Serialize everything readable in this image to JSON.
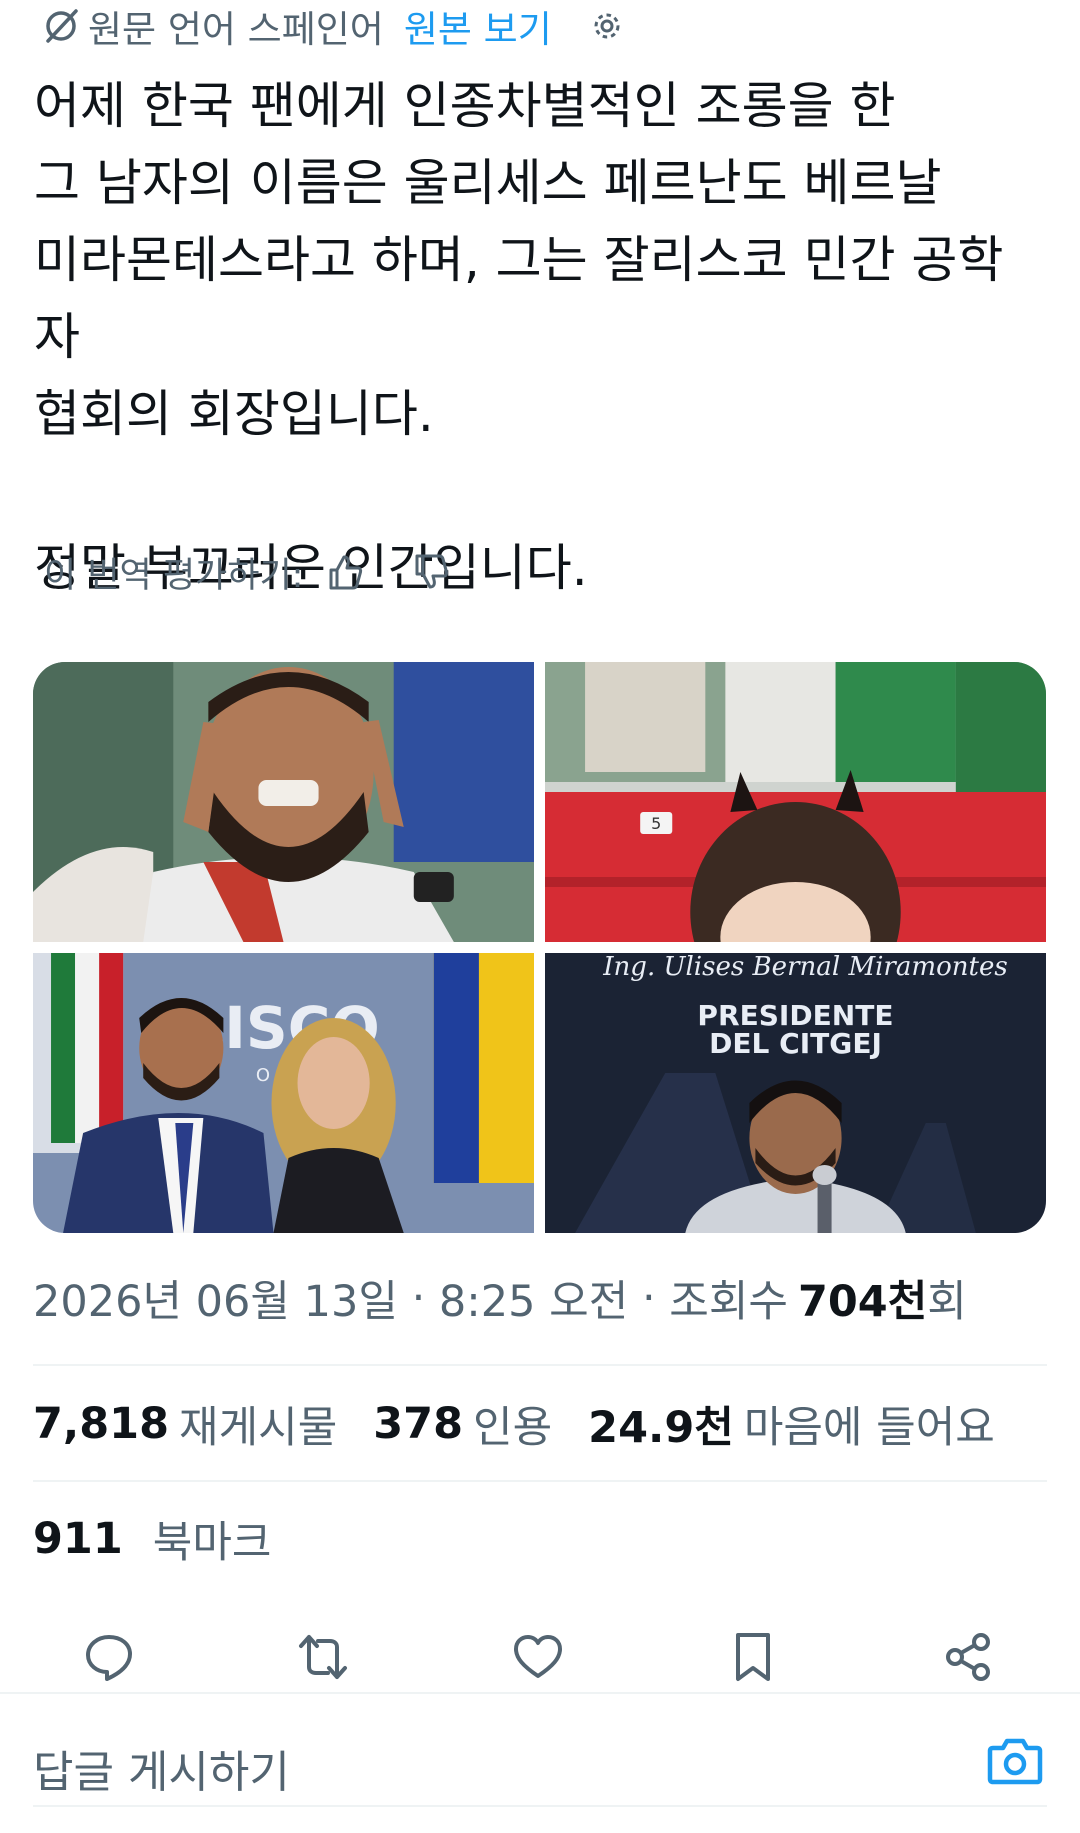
{
  "translation": {
    "source_language": "원문 언어 스페인어",
    "view_original": "원본 보기",
    "icons": {
      "translate": "translate-icon",
      "settings": "gear-icon"
    }
  },
  "tweet": {
    "text": "어제 한국 팬에게 인종차별적인 조롱을 한\n그 남자의 이름은 울리세스 페르난도 베르날\n미라몬테스라고 하며, 그는 잘리스코 민간 공학자\n협회의 회장입니다.\n\n정말 부끄러운 인간입니다.",
    "rate_label": "이 번역 평가하기:",
    "rate_icons": [
      "thumbs-up-icon",
      "thumbs-down-icon"
    ]
  },
  "media": {
    "image3_sign": "LISCO",
    "image3_sign_sub": "O DEL",
    "image4_signature": "Ing. Ulises Bernal Miramontes",
    "image4_title_line1": "PRESIDENTE",
    "image4_title_line2": "DEL CITGEJ",
    "seat_number": "5"
  },
  "meta": {
    "date": "2026년 06월 13일",
    "sep": "·",
    "time": "8:25 오전",
    "views_label": "조회수",
    "views_value": "704천",
    "views_suffix": "회"
  },
  "stats": {
    "reposts": {
      "value": "7,818",
      "label": "재게시물"
    },
    "quotes": {
      "value": "378",
      "label": "인용"
    },
    "likes": {
      "value": "24.9천",
      "label": "마음에 들어요"
    },
    "bookmarks": {
      "value": "911",
      "label": "북마크"
    }
  },
  "actions": [
    "reply-icon",
    "repost-icon",
    "like-icon",
    "bookmark-icon",
    "share-icon"
  ],
  "reply": {
    "placeholder": "답글 게시하기",
    "icon": "camera-icon"
  },
  "colors": {
    "accent": "#1d9bf0",
    "text": "#0f1419",
    "secondary": "#536471",
    "divider": "#eff3f4"
  }
}
